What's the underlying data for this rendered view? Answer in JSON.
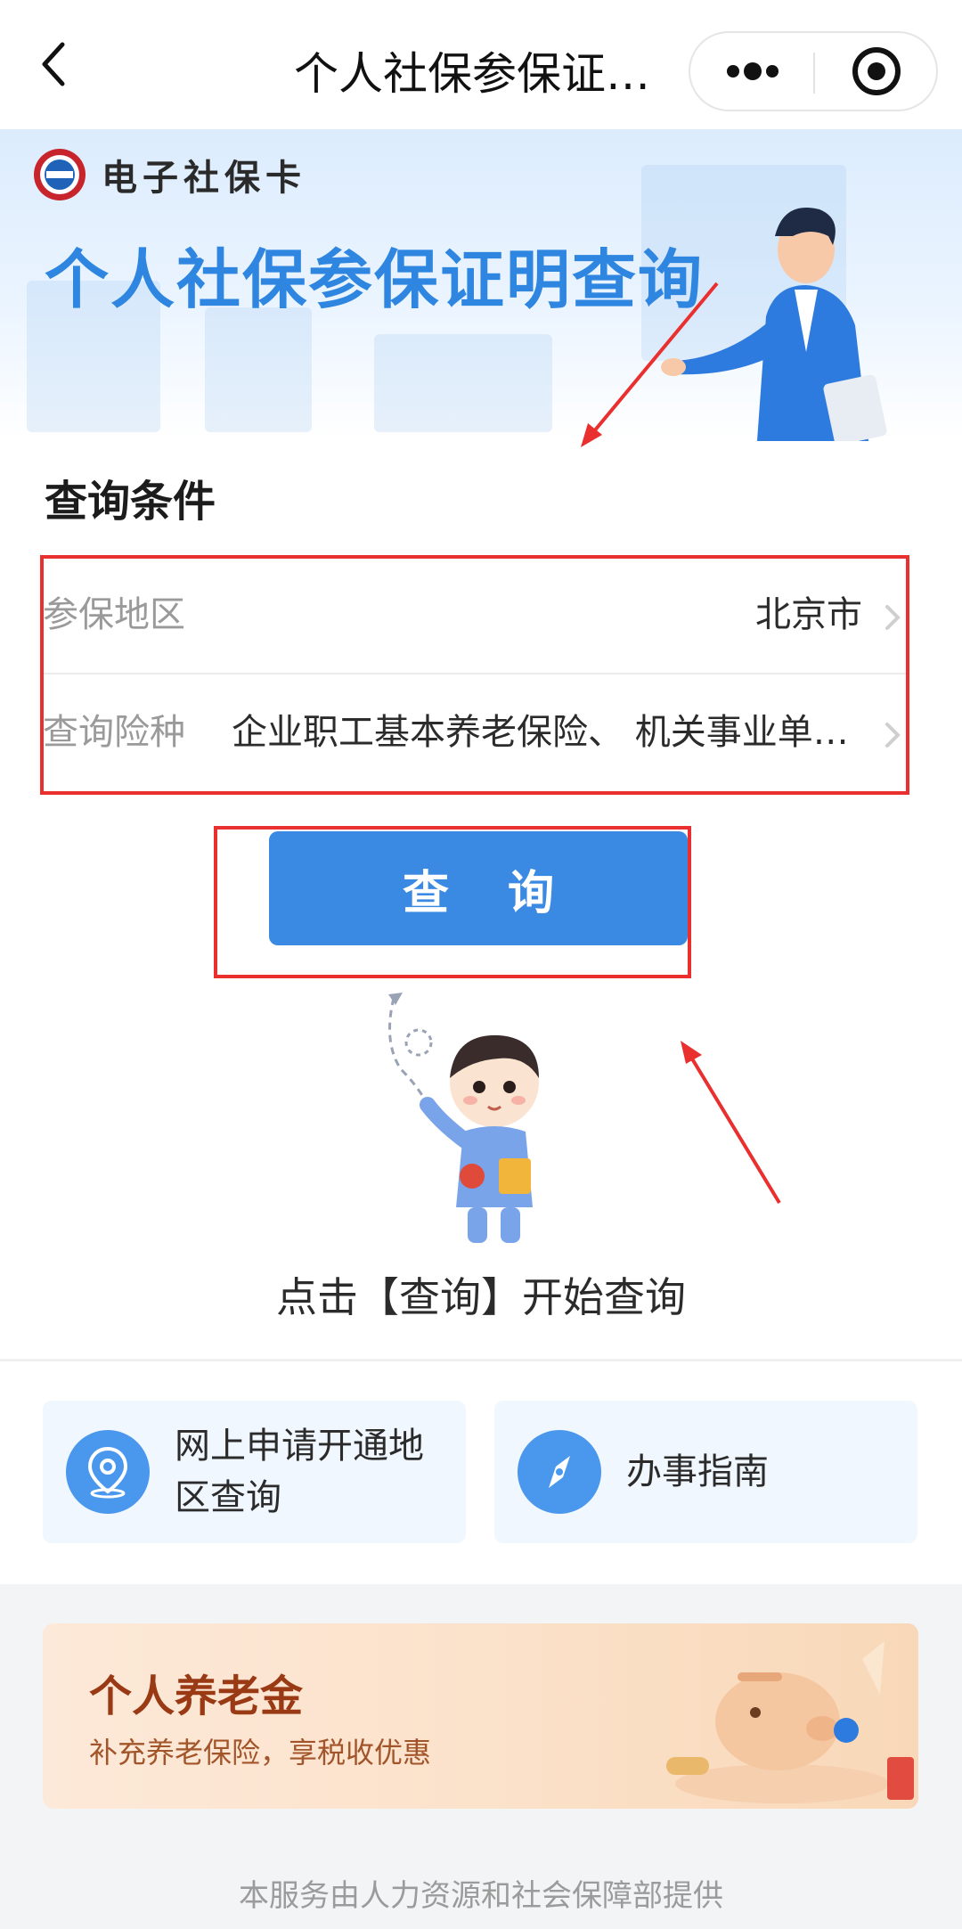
{
  "navbar": {
    "title": "个人社保参保证…"
  },
  "banner": {
    "logo_text": "电子社保卡",
    "title": "个人社保参保证明查询"
  },
  "form": {
    "section_title": "查询条件",
    "region_label": "参保地区",
    "region_value": "北京市",
    "insurance_label": "查询险种",
    "insurance_value": "企业职工基本养老保险、 机关事业单位…"
  },
  "query_button_label": "查 询",
  "hint": "点击【查询】开始查询",
  "services": [
    {
      "label": "网上申请开通地区查询",
      "icon": "location-pin-icon"
    },
    {
      "label": "办事指南",
      "icon": "compass-icon"
    }
  ],
  "promo": {
    "title": "个人养老金",
    "subtitle": "补充养老保险，享税收优惠"
  },
  "footer": "本服务由人力资源和社会保障部提供",
  "colors": {
    "primary": "#3a8ae3",
    "banner_title": "#2f86e0",
    "annotation_red": "#ea2f2f",
    "promo_title": "#9a3a15"
  }
}
